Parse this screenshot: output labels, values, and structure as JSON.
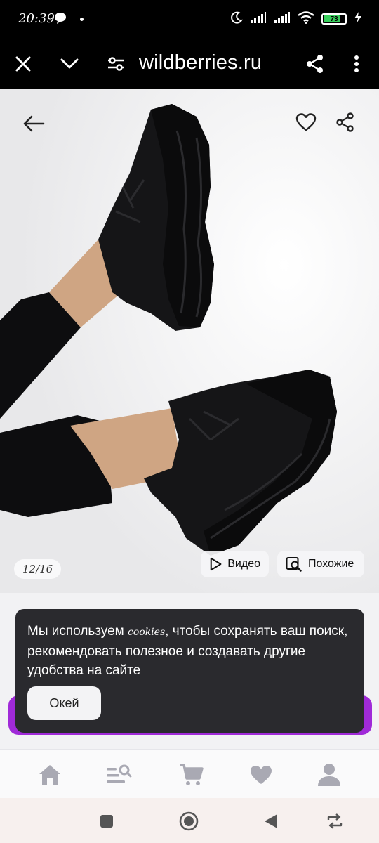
{
  "status_bar": {
    "time": "20:39",
    "battery_level": "73",
    "icons": [
      "chat-bubble-icon",
      "moon-icon",
      "signal-icon",
      "signal-icon",
      "wifi-icon",
      "battery-icon",
      "charging-icon"
    ]
  },
  "browser": {
    "url": "wildberries.ru",
    "icons": [
      "close-icon",
      "chevron-down-icon",
      "site-settings-icon",
      "share-icon",
      "more-icon"
    ]
  },
  "product": {
    "image_counter": "12/16",
    "video_label": "Видео",
    "similar_label": "Похожие",
    "icons": [
      "back-arrow-icon",
      "heart-icon",
      "share-icon",
      "play-icon",
      "image-search-icon"
    ]
  },
  "cookie_banner": {
    "text_before": "Мы используем ",
    "link_word": "cookies",
    "text_after": ", чтобы сохранять ваш поиск, рекомендовать полезное и создавать другие удобства на сайте",
    "ok_label": "Окей"
  },
  "bottom_nav": {
    "items": [
      "home-icon",
      "catalog-search-icon",
      "cart-icon",
      "favorites-icon",
      "profile-icon"
    ]
  },
  "system_nav": {
    "items": [
      "recents-square-icon",
      "home-circle-icon",
      "back-triangle-icon",
      "rotate-icon"
    ]
  },
  "colors": {
    "accent": "#a02ad8",
    "banner_bg": "#2a2a2e",
    "battery": "#38d05c",
    "nav_icon": "#a9a9b3"
  }
}
